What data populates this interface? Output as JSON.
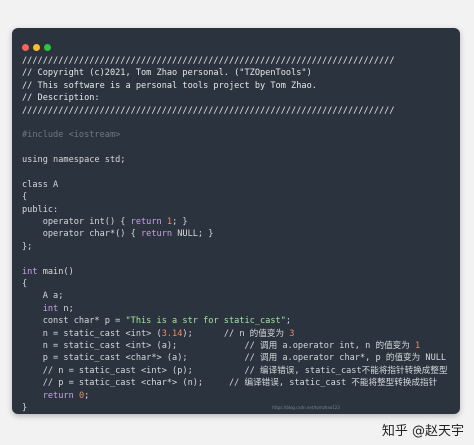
{
  "window": {
    "dots": [
      {
        "name": "close-dot",
        "color": "#ff5f57"
      },
      {
        "name": "minimize-dot",
        "color": "#febc2e"
      },
      {
        "name": "zoom-dot",
        "color": "#28c840"
      }
    ]
  },
  "code_lines": [
    [
      {
        "t": "////////////////////////////////////////////////////////////////////////",
        "c": "c-comment"
      }
    ],
    [
      {
        "t": "// Copyright (c)2021, Tom Zhao personal. (\"TZOpenTools\")",
        "c": "c-comment"
      }
    ],
    [
      {
        "t": "// This software is a personal tools project by Tom Zhao.",
        "c": "c-comment"
      }
    ],
    [
      {
        "t": "// Description:",
        "c": "c-comment"
      }
    ],
    [
      {
        "t": "////////////////////////////////////////////////////////////////////////",
        "c": "c-comment"
      }
    ],
    [],
    [
      {
        "t": "#include <iostream>",
        "c": "c-faint"
      }
    ],
    [],
    [
      {
        "t": "using namespace std;",
        "c": "c-plain"
      }
    ],
    [],
    [
      {
        "t": "class A",
        "c": "c-plain"
      }
    ],
    [
      {
        "t": "{",
        "c": "c-plain"
      }
    ],
    [
      {
        "t": "public:",
        "c": "c-plain"
      }
    ],
    [
      {
        "t": "    operator int() { ",
        "c": "c-plain"
      },
      {
        "t": "return",
        "c": "c-kw"
      },
      {
        "t": " ",
        "c": "c-plain"
      },
      {
        "t": "1",
        "c": "c-num"
      },
      {
        "t": "; }",
        "c": "c-plain"
      }
    ],
    [
      {
        "t": "    operator char*() { ",
        "c": "c-plain"
      },
      {
        "t": "return",
        "c": "c-kw"
      },
      {
        "t": " NULL; }",
        "c": "c-plain"
      }
    ],
    [
      {
        "t": "};",
        "c": "c-plain"
      }
    ],
    [],
    [
      {
        "t": "int",
        "c": "c-type"
      },
      {
        "t": " main()",
        "c": "c-plain"
      }
    ],
    [
      {
        "t": "{",
        "c": "c-plain"
      }
    ],
    [
      {
        "t": "    A a;",
        "c": "c-plain"
      }
    ],
    [
      {
        "t": "    ",
        "c": "c-plain"
      },
      {
        "t": "int",
        "c": "c-type"
      },
      {
        "t": " n;",
        "c": "c-plain"
      }
    ],
    [
      {
        "t": "    const char* p = ",
        "c": "c-plain"
      },
      {
        "t": "\"This is a str for static_cast\"",
        "c": "c-str"
      },
      {
        "t": ";",
        "c": "c-plain"
      }
    ],
    [
      {
        "t": "    n = static_cast <int> (",
        "c": "c-plain"
      },
      {
        "t": "3.14",
        "c": "c-num"
      },
      {
        "t": ");      ",
        "c": "c-plain"
      },
      {
        "t": "// n 的值变为 ",
        "c": "c-cmt"
      },
      {
        "t": "3",
        "c": "c-num"
      }
    ],
    [
      {
        "t": "    n = static_cast <int> (a);             ",
        "c": "c-plain"
      },
      {
        "t": "// 调用 a.operator int, n 的值变为 ",
        "c": "c-cmt"
      },
      {
        "t": "1",
        "c": "c-num"
      }
    ],
    [
      {
        "t": "    p = static_cast <char*> (a);           ",
        "c": "c-plain"
      },
      {
        "t": "// 调用 a.operator char*, p 的值变为 NULL",
        "c": "c-cmt"
      }
    ],
    [
      {
        "t": "    // n = static_cast <int> (p);          ",
        "c": "c-plain"
      },
      {
        "t": "// 编译错误, static_cast不能将指针转换成整型",
        "c": "c-cmt"
      }
    ],
    [
      {
        "t": "    // p = static_cast <char*> (n);     ",
        "c": "c-plain"
      },
      {
        "t": "// 编译错误, static_cast 不能将整型转换成指针",
        "c": "c-cmt"
      }
    ],
    [
      {
        "t": "    ",
        "c": "c-plain"
      },
      {
        "t": "return",
        "c": "c-kw"
      },
      {
        "t": " ",
        "c": "c-plain"
      },
      {
        "t": "0",
        "c": "c-num"
      },
      {
        "t": ";",
        "c": "c-plain"
      }
    ],
    [
      {
        "t": "}",
        "c": "c-plain"
      }
    ]
  ],
  "watermark": "知乎 @赵天宇",
  "tiny_url": "https://blog.csdn.net/tomzhao123"
}
